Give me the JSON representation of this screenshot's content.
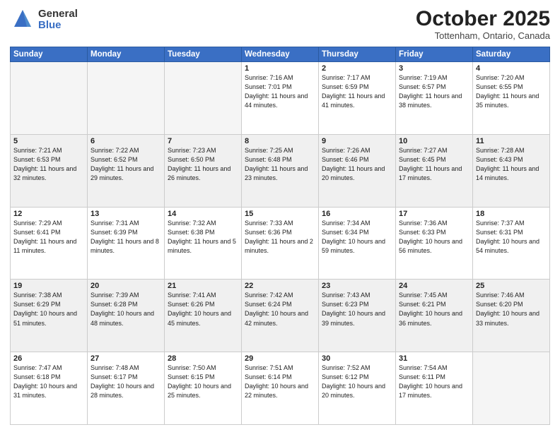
{
  "logo": {
    "general": "General",
    "blue": "Blue"
  },
  "header": {
    "month": "October 2025",
    "location": "Tottenham, Ontario, Canada"
  },
  "weekdays": [
    "Sunday",
    "Monday",
    "Tuesday",
    "Wednesday",
    "Thursday",
    "Friday",
    "Saturday"
  ],
  "weeks": [
    [
      {
        "day": "",
        "sunrise": "",
        "sunset": "",
        "daylight": "",
        "empty": true
      },
      {
        "day": "",
        "sunrise": "",
        "sunset": "",
        "daylight": "",
        "empty": true
      },
      {
        "day": "",
        "sunrise": "",
        "sunset": "",
        "daylight": "",
        "empty": true
      },
      {
        "day": "1",
        "sunrise": "Sunrise: 7:16 AM",
        "sunset": "Sunset: 7:01 PM",
        "daylight": "Daylight: 11 hours and 44 minutes."
      },
      {
        "day": "2",
        "sunrise": "Sunrise: 7:17 AM",
        "sunset": "Sunset: 6:59 PM",
        "daylight": "Daylight: 11 hours and 41 minutes."
      },
      {
        "day": "3",
        "sunrise": "Sunrise: 7:19 AM",
        "sunset": "Sunset: 6:57 PM",
        "daylight": "Daylight: 11 hours and 38 minutes."
      },
      {
        "day": "4",
        "sunrise": "Sunrise: 7:20 AM",
        "sunset": "Sunset: 6:55 PM",
        "daylight": "Daylight: 11 hours and 35 minutes."
      }
    ],
    [
      {
        "day": "5",
        "sunrise": "Sunrise: 7:21 AM",
        "sunset": "Sunset: 6:53 PM",
        "daylight": "Daylight: 11 hours and 32 minutes."
      },
      {
        "day": "6",
        "sunrise": "Sunrise: 7:22 AM",
        "sunset": "Sunset: 6:52 PM",
        "daylight": "Daylight: 11 hours and 29 minutes."
      },
      {
        "day": "7",
        "sunrise": "Sunrise: 7:23 AM",
        "sunset": "Sunset: 6:50 PM",
        "daylight": "Daylight: 11 hours and 26 minutes."
      },
      {
        "day": "8",
        "sunrise": "Sunrise: 7:25 AM",
        "sunset": "Sunset: 6:48 PM",
        "daylight": "Daylight: 11 hours and 23 minutes."
      },
      {
        "day": "9",
        "sunrise": "Sunrise: 7:26 AM",
        "sunset": "Sunset: 6:46 PM",
        "daylight": "Daylight: 11 hours and 20 minutes."
      },
      {
        "day": "10",
        "sunrise": "Sunrise: 7:27 AM",
        "sunset": "Sunset: 6:45 PM",
        "daylight": "Daylight: 11 hours and 17 minutes."
      },
      {
        "day": "11",
        "sunrise": "Sunrise: 7:28 AM",
        "sunset": "Sunset: 6:43 PM",
        "daylight": "Daylight: 11 hours and 14 minutes."
      }
    ],
    [
      {
        "day": "12",
        "sunrise": "Sunrise: 7:29 AM",
        "sunset": "Sunset: 6:41 PM",
        "daylight": "Daylight: 11 hours and 11 minutes."
      },
      {
        "day": "13",
        "sunrise": "Sunrise: 7:31 AM",
        "sunset": "Sunset: 6:39 PM",
        "daylight": "Daylight: 11 hours and 8 minutes."
      },
      {
        "day": "14",
        "sunrise": "Sunrise: 7:32 AM",
        "sunset": "Sunset: 6:38 PM",
        "daylight": "Daylight: 11 hours and 5 minutes."
      },
      {
        "day": "15",
        "sunrise": "Sunrise: 7:33 AM",
        "sunset": "Sunset: 6:36 PM",
        "daylight": "Daylight: 11 hours and 2 minutes."
      },
      {
        "day": "16",
        "sunrise": "Sunrise: 7:34 AM",
        "sunset": "Sunset: 6:34 PM",
        "daylight": "Daylight: 10 hours and 59 minutes."
      },
      {
        "day": "17",
        "sunrise": "Sunrise: 7:36 AM",
        "sunset": "Sunset: 6:33 PM",
        "daylight": "Daylight: 10 hours and 56 minutes."
      },
      {
        "day": "18",
        "sunrise": "Sunrise: 7:37 AM",
        "sunset": "Sunset: 6:31 PM",
        "daylight": "Daylight: 10 hours and 54 minutes."
      }
    ],
    [
      {
        "day": "19",
        "sunrise": "Sunrise: 7:38 AM",
        "sunset": "Sunset: 6:29 PM",
        "daylight": "Daylight: 10 hours and 51 minutes."
      },
      {
        "day": "20",
        "sunrise": "Sunrise: 7:39 AM",
        "sunset": "Sunset: 6:28 PM",
        "daylight": "Daylight: 10 hours and 48 minutes."
      },
      {
        "day": "21",
        "sunrise": "Sunrise: 7:41 AM",
        "sunset": "Sunset: 6:26 PM",
        "daylight": "Daylight: 10 hours and 45 minutes."
      },
      {
        "day": "22",
        "sunrise": "Sunrise: 7:42 AM",
        "sunset": "Sunset: 6:24 PM",
        "daylight": "Daylight: 10 hours and 42 minutes."
      },
      {
        "day": "23",
        "sunrise": "Sunrise: 7:43 AM",
        "sunset": "Sunset: 6:23 PM",
        "daylight": "Daylight: 10 hours and 39 minutes."
      },
      {
        "day": "24",
        "sunrise": "Sunrise: 7:45 AM",
        "sunset": "Sunset: 6:21 PM",
        "daylight": "Daylight: 10 hours and 36 minutes."
      },
      {
        "day": "25",
        "sunrise": "Sunrise: 7:46 AM",
        "sunset": "Sunset: 6:20 PM",
        "daylight": "Daylight: 10 hours and 33 minutes."
      }
    ],
    [
      {
        "day": "26",
        "sunrise": "Sunrise: 7:47 AM",
        "sunset": "Sunset: 6:18 PM",
        "daylight": "Daylight: 10 hours and 31 minutes."
      },
      {
        "day": "27",
        "sunrise": "Sunrise: 7:48 AM",
        "sunset": "Sunset: 6:17 PM",
        "daylight": "Daylight: 10 hours and 28 minutes."
      },
      {
        "day": "28",
        "sunrise": "Sunrise: 7:50 AM",
        "sunset": "Sunset: 6:15 PM",
        "daylight": "Daylight: 10 hours and 25 minutes."
      },
      {
        "day": "29",
        "sunrise": "Sunrise: 7:51 AM",
        "sunset": "Sunset: 6:14 PM",
        "daylight": "Daylight: 10 hours and 22 minutes."
      },
      {
        "day": "30",
        "sunrise": "Sunrise: 7:52 AM",
        "sunset": "Sunset: 6:12 PM",
        "daylight": "Daylight: 10 hours and 20 minutes."
      },
      {
        "day": "31",
        "sunrise": "Sunrise: 7:54 AM",
        "sunset": "Sunset: 6:11 PM",
        "daylight": "Daylight: 10 hours and 17 minutes."
      },
      {
        "day": "",
        "sunrise": "",
        "sunset": "",
        "daylight": "",
        "empty": true
      }
    ]
  ]
}
